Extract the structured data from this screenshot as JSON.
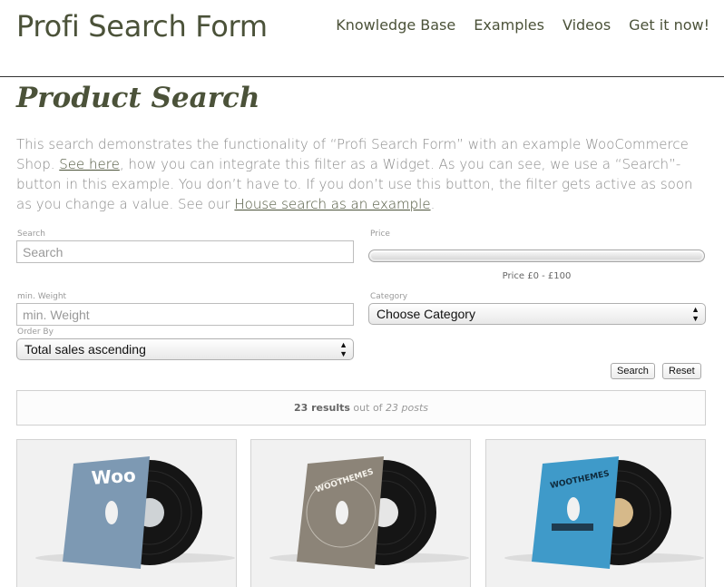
{
  "site": {
    "title": "Profi Search Form",
    "nav": [
      "Knowledge Base",
      "Examples",
      "Videos",
      "Get it now!"
    ]
  },
  "page": {
    "heading": "Product Search",
    "intro": {
      "part1": "This search demonstrates the functionality of “Profi Search Form” with an example WooCommerce Shop. ",
      "link1": "See here",
      "part2": ", how you can integrate this filter as a Widget. As you can see, we use a “Search”-button in this example. You don’t have to. If you don’t use this button, the filter gets active as soon as you change a value. See our ",
      "link2": "House search as an example",
      "part3": "."
    }
  },
  "form": {
    "search": {
      "label": "Search",
      "placeholder": "Search",
      "value": ""
    },
    "price": {
      "label": "Price",
      "range_text": "Price £0 - £100",
      "min": 0,
      "max": 100,
      "selected_min": 0,
      "selected_max": 100
    },
    "min_weight": {
      "label": "min. Weight",
      "placeholder": "min. Weight",
      "value": ""
    },
    "category": {
      "label": "Category",
      "selected": "Choose Category"
    },
    "order_by": {
      "label": "Order By",
      "selected": "Total sales ascending"
    },
    "search_button": "Search",
    "reset_button": "Reset"
  },
  "results": {
    "count": "23 results",
    "middle": " out of ",
    "total": "23 posts"
  },
  "products": [
    {
      "cover_text": "Woo",
      "cover_color": "#7d99b3",
      "disc_label_color": "#cfd3d6"
    },
    {
      "cover_text": "WOOTHEMES",
      "cover_color": "#8c8478",
      "disc_label_color": "#e6e6e6"
    },
    {
      "cover_text": "WOOTHEMES",
      "cover_color": "#3f9ac9",
      "disc_label_color": "#d6b98a"
    }
  ],
  "colors": {
    "brand_text": "#4b5239",
    "body_text": "#8a8a8a",
    "card_bg": "#f1f1f1"
  }
}
